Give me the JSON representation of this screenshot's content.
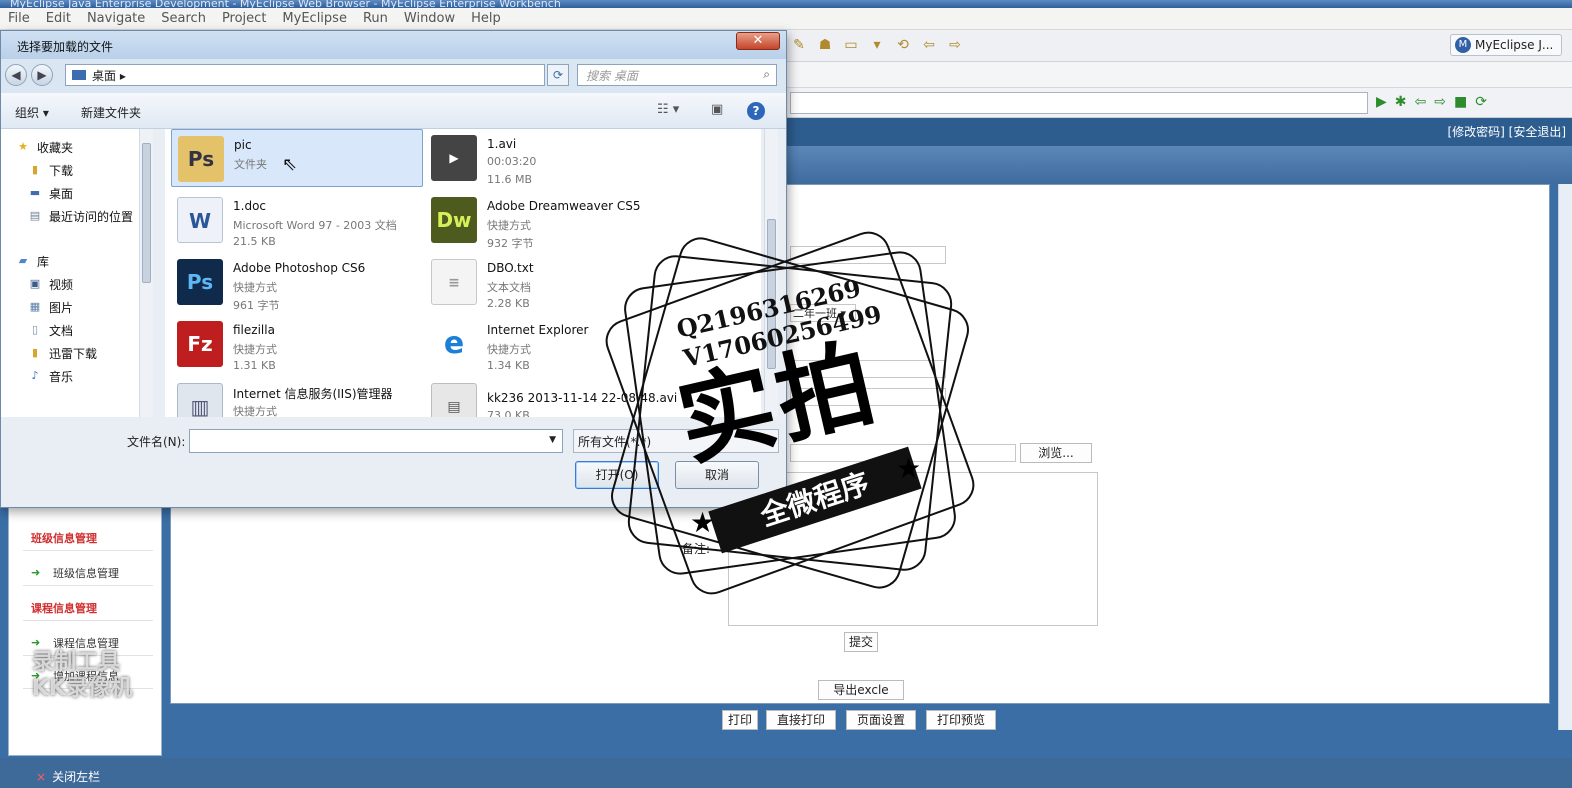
{
  "ide": {
    "title": "MyEclipse Java Enterprise Development - MyEclipse Web Browser - MyEclipse Enterprise Workbench",
    "menu": [
      "File",
      "Edit",
      "Navigate",
      "Search",
      "Project",
      "MyEclipse",
      "Run",
      "Window",
      "Help"
    ],
    "perspective": "MyEclipse J...",
    "perspective_icon": "M"
  },
  "app": {
    "header_links": "[修改密码] [安全退出]",
    "sidebar": {
      "items": [
        {
          "type": "category",
          "label": "班级信息管理"
        },
        {
          "type": "link",
          "label": "班级信息管理"
        },
        {
          "type": "category",
          "label": "课程信息管理"
        },
        {
          "type": "link",
          "label": "课程信息管理"
        },
        {
          "type": "link",
          "label": "增加课程信息"
        }
      ]
    },
    "form": {
      "class_select": "二年一班",
      "browse_button": "浏览...",
      "remarks_label": "备注:",
      "submit_button": "提交",
      "export_button": "导出excle"
    },
    "print_buttons": [
      "打印",
      "直接打印",
      "页面设置",
      "打印预览"
    ],
    "close_sidebar": "关闭左栏",
    "close_icon": "×"
  },
  "dialog": {
    "title": "选择要加载的文件",
    "close_glyph": "✕",
    "address": "桌面",
    "search_placeholder": "搜索 桌面",
    "organize": "组织 ▾",
    "new_folder": "新建文件夹",
    "nav": {
      "favorites": "收藏夹",
      "favorites_items": [
        "下载",
        "桌面",
        "最近访问的位置"
      ],
      "libraries": "库",
      "library_items": [
        "视频",
        "图片",
        "文档",
        "迅雷下载",
        "音乐"
      ]
    },
    "files": [
      {
        "name": "pic",
        "line2": "文件夹",
        "line3": "",
        "icon": "folder-icon",
        "selected": true
      },
      {
        "name": "1.avi",
        "line2": "00:03:20",
        "line3": "11.6 MB",
        "icon": "video-icon",
        "selected": false
      },
      {
        "name": "1.doc",
        "line2": "Microsoft Word 97 - 2003 文档",
        "line3": "21.5 KB",
        "icon": "word-icon",
        "selected": false
      },
      {
        "name": "Adobe Dreamweaver CS5",
        "line2": "快捷方式",
        "line3": "932 字节",
        "icon": "dreamweaver-icon",
        "selected": false
      },
      {
        "name": "Adobe Photoshop CS6",
        "line2": "快捷方式",
        "line3": "961 字节",
        "icon": "photoshop-icon",
        "selected": false
      },
      {
        "name": "DBO.txt",
        "line2": "文本文档",
        "line3": "2.28 KB",
        "icon": "text-file-icon",
        "selected": false
      },
      {
        "name": "filezilla",
        "line2": "快捷方式",
        "line3": "1.31 KB",
        "icon": "filezilla-icon",
        "selected": false
      },
      {
        "name": "Internet Explorer",
        "line2": "快捷方式",
        "line3": "1.34 KB",
        "icon": "ie-icon",
        "selected": false
      },
      {
        "name": "Internet 信息服务(IIS)管理器",
        "line2": "快捷方式",
        "line3": "",
        "icon": "iis-icon",
        "selected": false
      },
      {
        "name": "kk236 2013-11-14 22-08-48.avi",
        "line2": "73.0 KB",
        "line3": "",
        "icon": "video-icon",
        "selected": false
      }
    ],
    "filename_label": "文件名(N):",
    "filename_value": "",
    "filetype": "所有文件(*.*)",
    "open_button": "打开(O)",
    "cancel_button": "取消"
  },
  "watermarks": {
    "stamp_line1": "Q2196316269",
    "stamp_line2": "V17060256499",
    "stamp_big": "实拍",
    "stamp_ribbon": "全微程序",
    "kk_line1": "录制工具",
    "kk_line2": "KK录像机"
  }
}
